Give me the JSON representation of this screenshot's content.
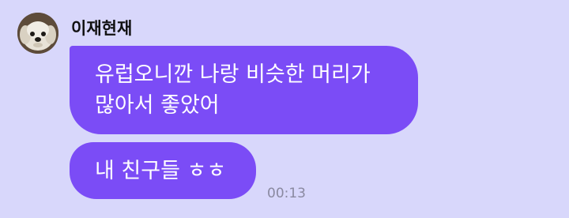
{
  "sender": {
    "name": "이재현재",
    "avatar_icon": "dog-avatar-icon"
  },
  "messages": [
    {
      "lines": [
        "유럽오니깐 나랑 비슷한 머리가",
        "많아서 좋았어"
      ]
    },
    {
      "text": "내 친구들 ㅎㅎ",
      "time": "00:13"
    }
  ],
  "colors": {
    "background": "#d8d7fb",
    "bubble": "#7b4cf6",
    "bubble_text": "#ffffff",
    "name_text": "#111111",
    "time_text": "#8a89a0"
  }
}
